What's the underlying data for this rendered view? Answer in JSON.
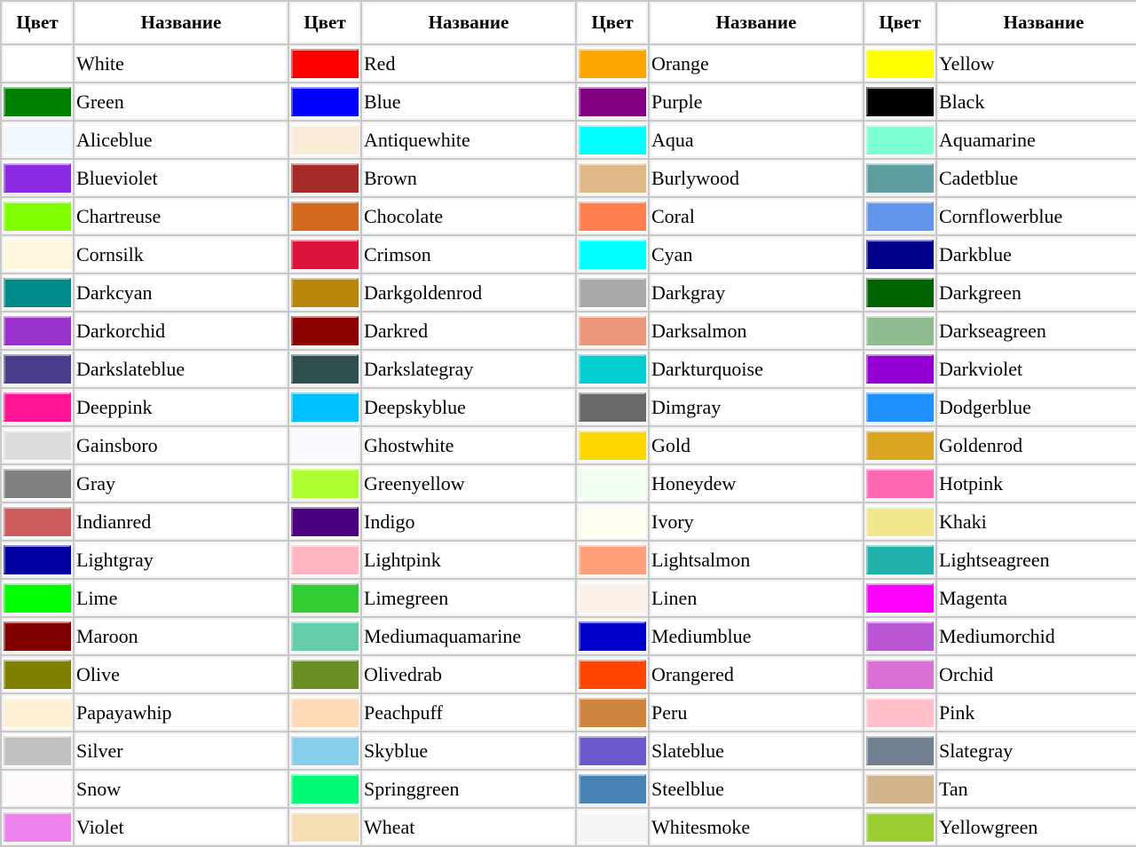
{
  "table": {
    "headers": {
      "color": "Цвет",
      "name": "Название"
    },
    "column_pairs": 4,
    "row_count": 22,
    "rows": [
      [
        {
          "hex": "#ffffff",
          "name": "White"
        },
        {
          "hex": "#ff0000",
          "name": "Red"
        },
        {
          "hex": "#ffa500",
          "name": "Orange"
        },
        {
          "hex": "#ffff00",
          "name": "Yellow"
        }
      ],
      [
        {
          "hex": "#008000",
          "name": "Green"
        },
        {
          "hex": "#0000ff",
          "name": "Blue"
        },
        {
          "hex": "#800080",
          "name": "Purple"
        },
        {
          "hex": "#000000",
          "name": "Black"
        }
      ],
      [
        {
          "hex": "#f0f8ff",
          "name": "Aliceblue"
        },
        {
          "hex": "#faebd7",
          "name": "Antiquewhite"
        },
        {
          "hex": "#00ffff",
          "name": "Aqua"
        },
        {
          "hex": "#7fffd4",
          "name": "Aquamarine"
        }
      ],
      [
        {
          "hex": "#8a2be2",
          "name": "Blueviolet"
        },
        {
          "hex": "#a52a2a",
          "name": "Brown"
        },
        {
          "hex": "#deb887",
          "name": "Burlywood"
        },
        {
          "hex": "#5f9ea0",
          "name": "Cadetblue"
        }
      ],
      [
        {
          "hex": "#7fff00",
          "name": "Chartreuse"
        },
        {
          "hex": "#d2691e",
          "name": "Chocolate"
        },
        {
          "hex": "#ff7f50",
          "name": "Coral"
        },
        {
          "hex": "#6495ed",
          "name": "Cornflowerblue"
        }
      ],
      [
        {
          "hex": "#fff8dc",
          "name": "Cornsilk"
        },
        {
          "hex": "#dc143c",
          "name": "Crimson"
        },
        {
          "hex": "#00ffff",
          "name": "Cyan"
        },
        {
          "hex": "#00008b",
          "name": "Darkblue"
        }
      ],
      [
        {
          "hex": "#008b8b",
          "name": "Darkcyan"
        },
        {
          "hex": "#b8860b",
          "name": "Darkgoldenrod"
        },
        {
          "hex": "#a9a9a9",
          "name": "Darkgray"
        },
        {
          "hex": "#006400",
          "name": "Darkgreen"
        }
      ],
      [
        {
          "hex": "#9932cc",
          "name": "Darkorchid"
        },
        {
          "hex": "#8b0000",
          "name": "Darkred"
        },
        {
          "hex": "#e9967a",
          "name": "Darksalmon"
        },
        {
          "hex": "#8fbc8f",
          "name": "Darkseagreen"
        }
      ],
      [
        {
          "hex": "#483d8b",
          "name": "Darkslateblue"
        },
        {
          "hex": "#2f4f4f",
          "name": "Darkslategray"
        },
        {
          "hex": "#00ced1",
          "name": "Darkturquoise"
        },
        {
          "hex": "#9400d3",
          "name": "Darkviolet"
        }
      ],
      [
        {
          "hex": "#ff1493",
          "name": "Deeppink"
        },
        {
          "hex": "#00bfff",
          "name": "Deepskyblue"
        },
        {
          "hex": "#696969",
          "name": "Dimgray"
        },
        {
          "hex": "#1e90ff",
          "name": "Dodgerblue"
        }
      ],
      [
        {
          "hex": "#dcdcdc",
          "name": "Gainsboro"
        },
        {
          "hex": "#f8f8ff",
          "name": "Ghostwhite"
        },
        {
          "hex": "#ffd700",
          "name": "Gold"
        },
        {
          "hex": "#daa520",
          "name": "Goldenrod"
        }
      ],
      [
        {
          "hex": "#808080",
          "name": "Gray"
        },
        {
          "hex": "#adff2f",
          "name": "Greenyellow"
        },
        {
          "hex": "#f0fff0",
          "name": "Honeydew"
        },
        {
          "hex": "#ff69b4",
          "name": "Hotpink"
        }
      ],
      [
        {
          "hex": "#cd5c5c",
          "name": "Indianred"
        },
        {
          "hex": "#4b0082",
          "name": "Indigo"
        },
        {
          "hex": "#fffff0",
          "name": "Ivory"
        },
        {
          "hex": "#f0e68c",
          "name": "Khaki"
        }
      ],
      [
        {
          "hex": "#0000a0",
          "name": "Lightgray"
        },
        {
          "hex": "#ffb6c1",
          "name": "Lightpink"
        },
        {
          "hex": "#ffa07a",
          "name": "Lightsalmon"
        },
        {
          "hex": "#20b2aa",
          "name": "Lightseagreen"
        }
      ],
      [
        {
          "hex": "#00ff00",
          "name": "Lime"
        },
        {
          "hex": "#32cd32",
          "name": "Limegreen"
        },
        {
          "hex": "#faf0e6",
          "name": "Linen"
        },
        {
          "hex": "#ff00ff",
          "name": "Magenta"
        }
      ],
      [
        {
          "hex": "#800000",
          "name": "Maroon"
        },
        {
          "hex": "#66cdaa",
          "name": "Mediumaquamarine"
        },
        {
          "hex": "#0000cd",
          "name": "Mediumblue"
        },
        {
          "hex": "#ba55d3",
          "name": "Mediumorchid"
        }
      ],
      [
        {
          "hex": "#808000",
          "name": "Olive"
        },
        {
          "hex": "#6b8e23",
          "name": "Olivedrab"
        },
        {
          "hex": "#ff4500",
          "name": "Orangered"
        },
        {
          "hex": "#da70d6",
          "name": "Orchid"
        }
      ],
      [
        {
          "hex": "#ffefd5",
          "name": "Papayawhip"
        },
        {
          "hex": "#ffdab9",
          "name": "Peachpuff"
        },
        {
          "hex": "#cd853f",
          "name": "Peru"
        },
        {
          "hex": "#ffc0cb",
          "name": "Pink"
        }
      ],
      [
        {
          "hex": "#c0c0c0",
          "name": "Silver"
        },
        {
          "hex": "#87ceeb",
          "name": "Skyblue"
        },
        {
          "hex": "#6a5acd",
          "name": "Slateblue"
        },
        {
          "hex": "#708090",
          "name": "Slategray"
        }
      ],
      [
        {
          "hex": "#fffafa",
          "name": "Snow"
        },
        {
          "hex": "#00fa76",
          "name": "Springgreen"
        },
        {
          "hex": "#4682b4",
          "name": "Steelblue"
        },
        {
          "hex": "#d2b48c",
          "name": "Tan"
        }
      ],
      [
        {
          "hex": "#ee82ee",
          "name": "Violet"
        },
        {
          "hex": "#f5deb3",
          "name": "Wheat"
        },
        {
          "hex": "#f5f5f5",
          "name": "Whitesmoke"
        },
        {
          "hex": "#9acd32",
          "name": "Yellowgreen"
        }
      ]
    ]
  }
}
